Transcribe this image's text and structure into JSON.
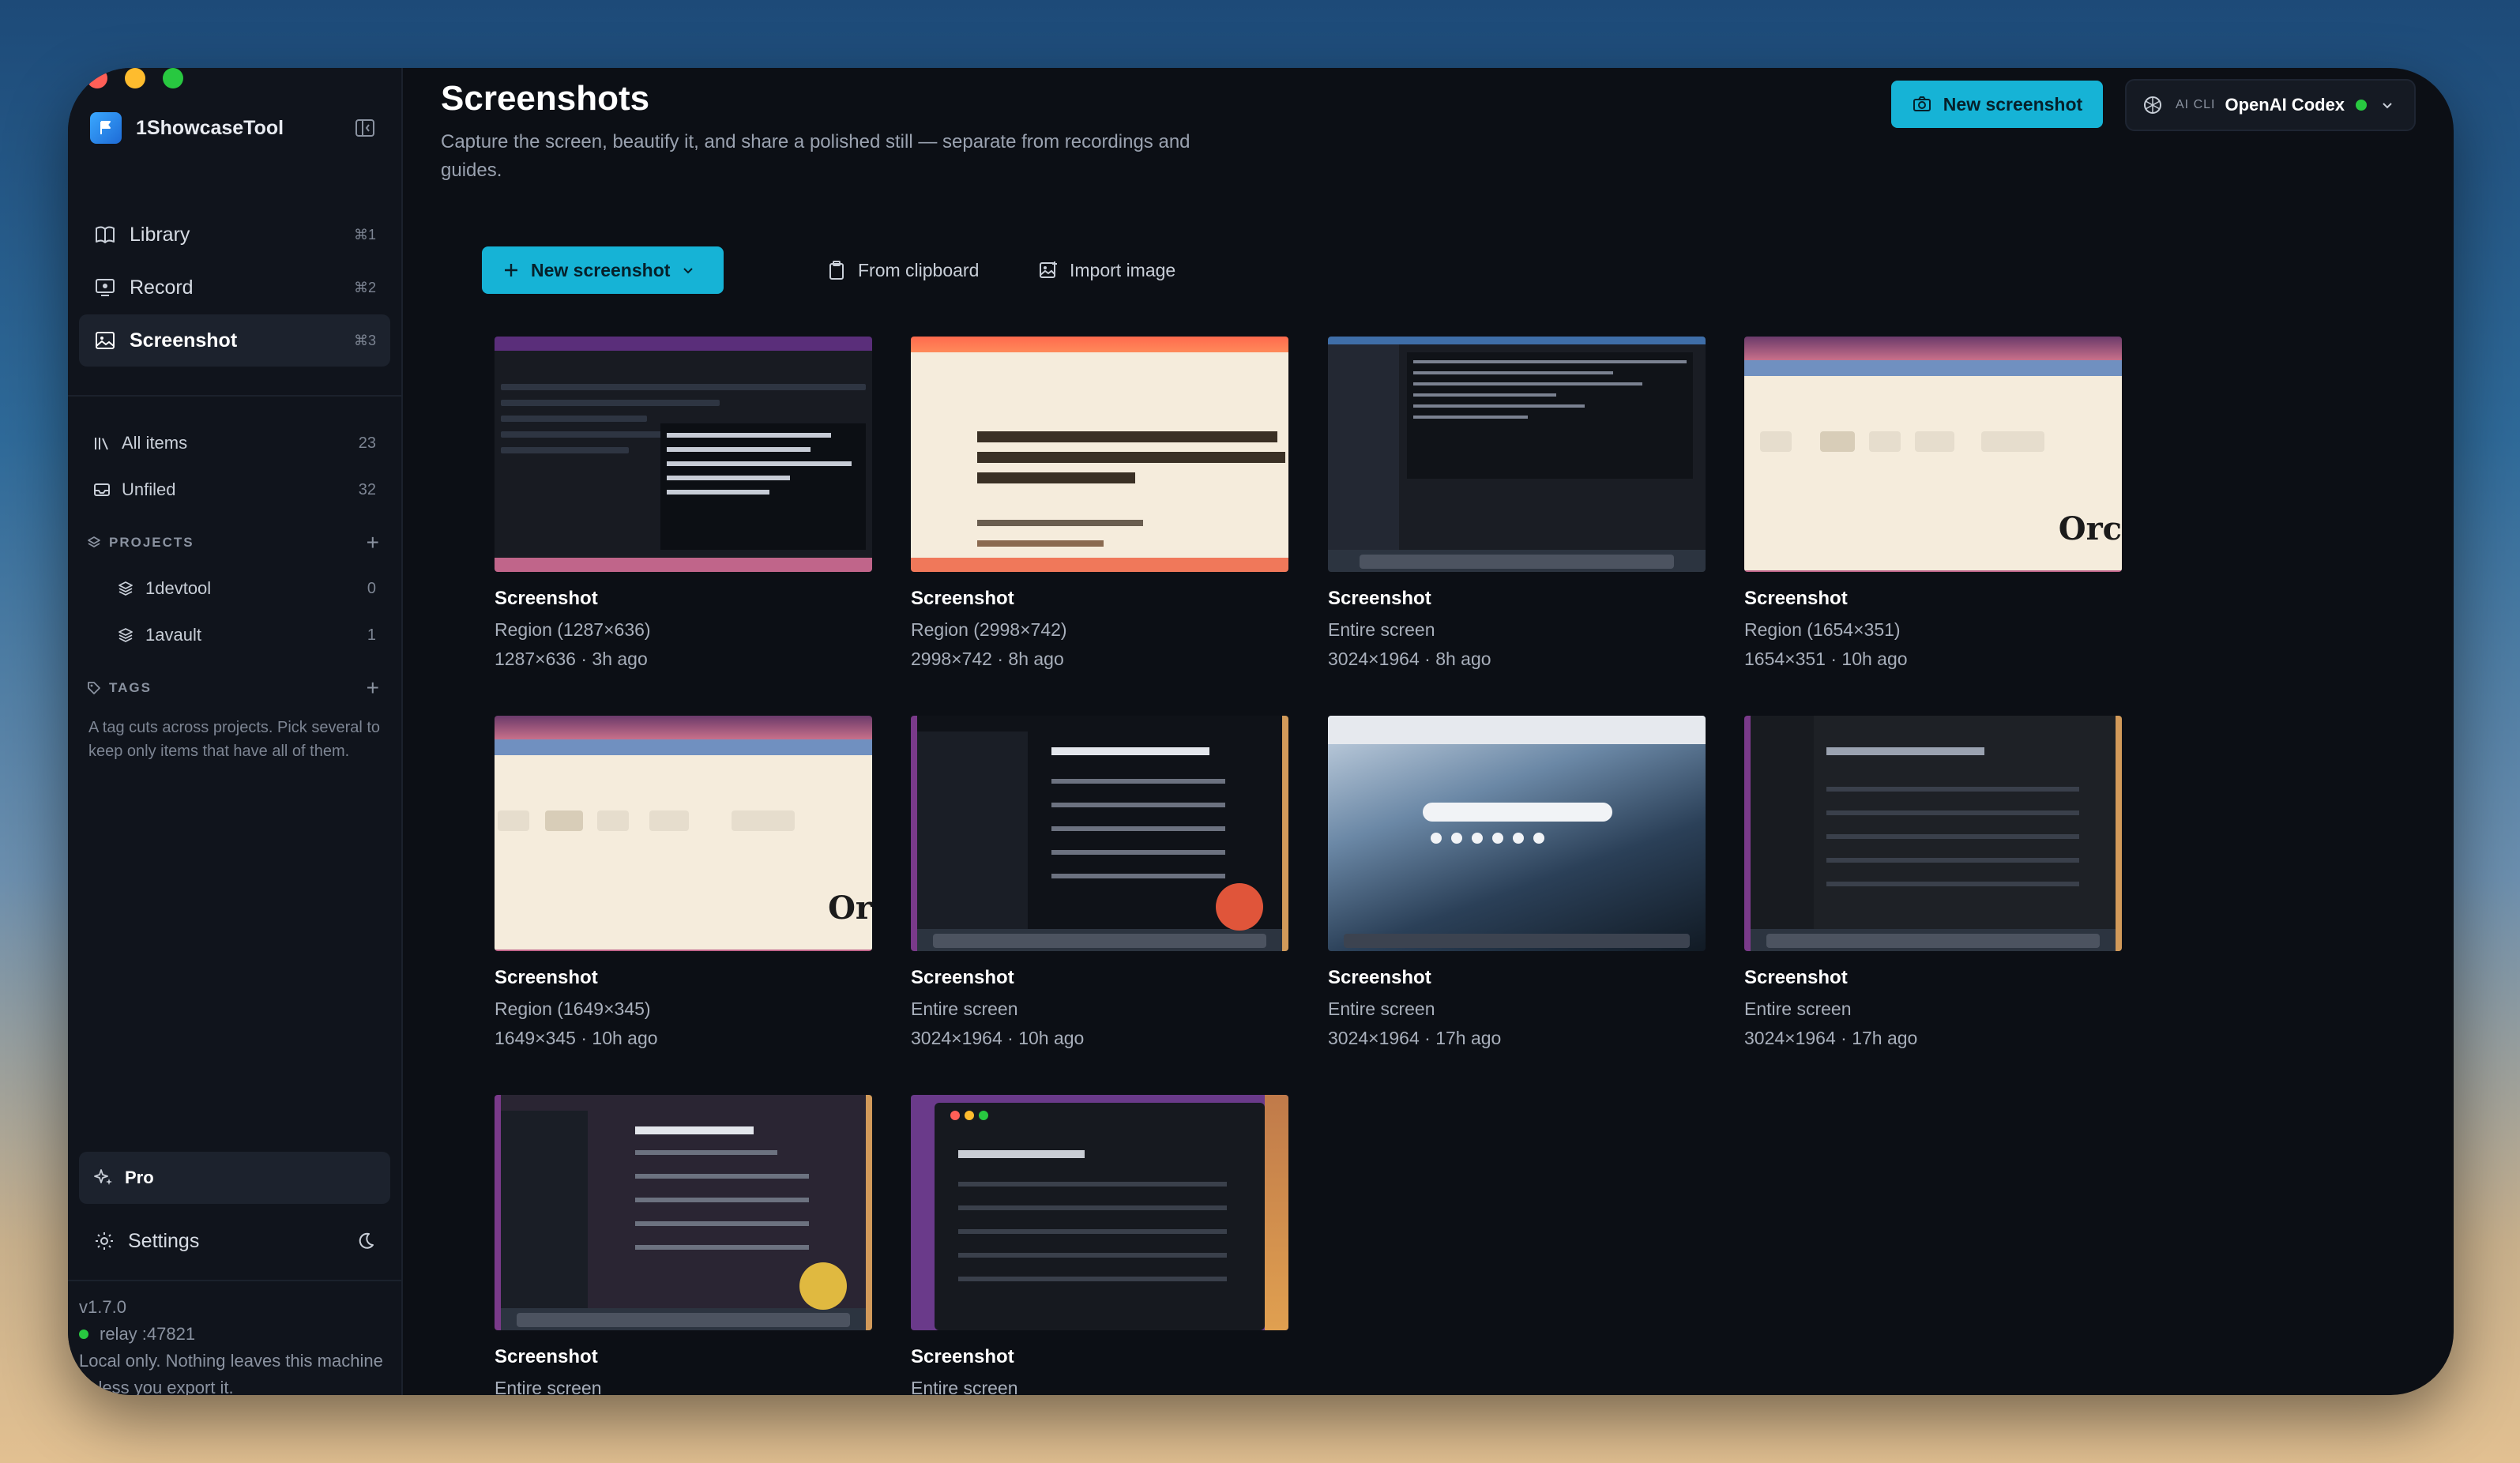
{
  "app": {
    "name": "1ShowcaseTool",
    "version": "v1.7.0",
    "relay": "relay :47821",
    "privacy_note": "Local only. Nothing leaves this machine unless you export it."
  },
  "sidebar": {
    "nav": [
      {
        "label": "Library",
        "shortcut": "⌘1",
        "icon": "book-icon"
      },
      {
        "label": "Record",
        "shortcut": "⌘2",
        "icon": "monitor-record-icon"
      },
      {
        "label": "Screenshot",
        "shortcut": "⌘3",
        "icon": "image-icon",
        "active": true
      }
    ],
    "filters": [
      {
        "label": "All items",
        "count": "23",
        "icon": "library-icon"
      },
      {
        "label": "Unfiled",
        "count": "32",
        "icon": "inbox-icon"
      }
    ],
    "projects_header": "PROJECTS",
    "projects": [
      {
        "label": "1devtool",
        "count": "0"
      },
      {
        "label": "1avault",
        "count": "1"
      }
    ],
    "tags_header": "TAGS",
    "tags_help": "A tag cuts across projects. Pick several to keep only items that have all of them.",
    "pro_label": "Pro",
    "settings_label": "Settings"
  },
  "header": {
    "title": "Screenshots",
    "subtitle": "Capture the screen, beautify it, and share a polished still — separate from recordings and guides.",
    "new_button": "New screenshot",
    "ai": {
      "prefix": "AI CLI",
      "name": "OpenAI Codex"
    }
  },
  "toolbar": {
    "new_label": "New screenshot",
    "clipboard_label": "From clipboard",
    "import_label": "Import image"
  },
  "items": [
    {
      "title": "Screenshot",
      "subtitle": "Region (1287×636)",
      "meta": "1287×636 · 3h ago"
    },
    {
      "title": "Screenshot",
      "subtitle": "Region (2998×742)",
      "meta": "2998×742 · 8h ago"
    },
    {
      "title": "Screenshot",
      "subtitle": "Entire screen",
      "meta": "3024×1964 · 8h ago"
    },
    {
      "title": "Screenshot",
      "subtitle": "Region (1654×351)",
      "meta": "1654×351 · 10h ago"
    },
    {
      "title": "Screenshot",
      "subtitle": "Region (1649×345)",
      "meta": "1649×345 · 10h ago"
    },
    {
      "title": "Screenshot",
      "subtitle": "Entire screen",
      "meta": "3024×1964 · 10h ago"
    },
    {
      "title": "Screenshot",
      "subtitle": "Entire screen",
      "meta": "3024×1964 · 17h ago"
    },
    {
      "title": "Screenshot",
      "subtitle": "Entire screen",
      "meta": "3024×1964 · 17h ago"
    },
    {
      "title": "Screenshot",
      "subtitle": "Entire screen",
      "meta": ""
    },
    {
      "title": "Screenshot",
      "subtitle": "Entire screen",
      "meta": ""
    }
  ],
  "colors": {
    "accent": "#16b3d6",
    "background": "#0c0f15",
    "sidebar": "#10141c"
  }
}
